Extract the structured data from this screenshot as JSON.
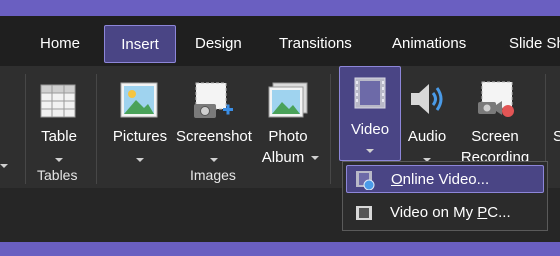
{
  "tabs": [
    {
      "label": "Home"
    },
    {
      "label": "Insert",
      "active": true
    },
    {
      "label": "Design"
    },
    {
      "label": "Transitions"
    },
    {
      "label": "Animations"
    },
    {
      "label": "Slide Sh"
    }
  ],
  "groups": {
    "tables": {
      "label": "Tables",
      "table_button": "Table"
    },
    "images": {
      "label": "Images",
      "pictures": "Pictures",
      "screenshot": "Screenshot",
      "photo_album_line1": "Photo",
      "photo_album_line2": "Album"
    },
    "media": {
      "video": "Video",
      "audio": "Audio",
      "screen_recording_line1": "Screen",
      "screen_recording_line2": "Recording"
    }
  },
  "video_menu": {
    "items": [
      {
        "pre": "",
        "u": "O",
        "post": "nline Video..."
      },
      {
        "pre": "Video on My ",
        "u": "P",
        "post": "C..."
      }
    ]
  },
  "colors": {
    "accent": "#8d86d9",
    "selected_bg": "#4a4585",
    "frame": "#6a5fc1"
  }
}
